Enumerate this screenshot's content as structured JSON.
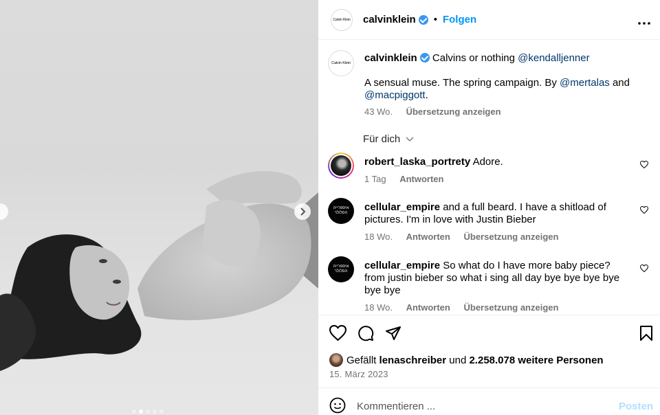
{
  "media": {
    "carousel_dots": 5,
    "active_dot": 1
  },
  "header": {
    "username": "calvinklein",
    "logo_text": "Calvin Klein",
    "bullet": "•",
    "follow_label": "Folgen",
    "more": "•••"
  },
  "caption": {
    "username": "calvinklein",
    "line1_text": "Calvins or nothing",
    "line1_mention": "@kendalljenner",
    "line2_text": "A sensual muse. The spring campaign. By",
    "mention2": "@mertalas",
    "and": "and",
    "mention3": "@macpiggott",
    "period": ".",
    "age": "43 Wo.",
    "translate": "Übersetzung anzeigen"
  },
  "fuer_dich": "Für dich",
  "comments": [
    {
      "username": "robert_laska_portrety",
      "text": "Adore.",
      "age": "1 Tag",
      "reply": "Antworten",
      "translate": ""
    },
    {
      "username": "cellular_empire",
      "text": "and a full beard. I have a shitload of pictures. I'm in love with Justin Bieber",
      "age": "18 Wo.",
      "reply": "Antworten",
      "translate": "Übersetzung anzeigen",
      "avatar_text": "איספרייה הסלולר"
    },
    {
      "username": "cellular_empire",
      "text": "So what do I have more baby piece? from justin bieber so what i sing all day bye bye bye bye bye bye",
      "age": "18 Wo.",
      "reply": "Antworten",
      "translate": "Übersetzung anzeigen",
      "avatar_text": "איספרייה הסלולר"
    }
  ],
  "likes": {
    "prefix": "Gefällt",
    "user": "lenaschreiber",
    "and": "und",
    "count": "2.258.078 weitere Personen"
  },
  "date": "15. März 2023",
  "compose": {
    "placeholder": "Kommentieren ...",
    "post_label": "Posten"
  },
  "colors": {
    "accent": "#0095f6",
    "link": "#00376b",
    "muted": "#737373",
    "post_disabled": "#b2dffc",
    "verified": "#3897f0"
  }
}
